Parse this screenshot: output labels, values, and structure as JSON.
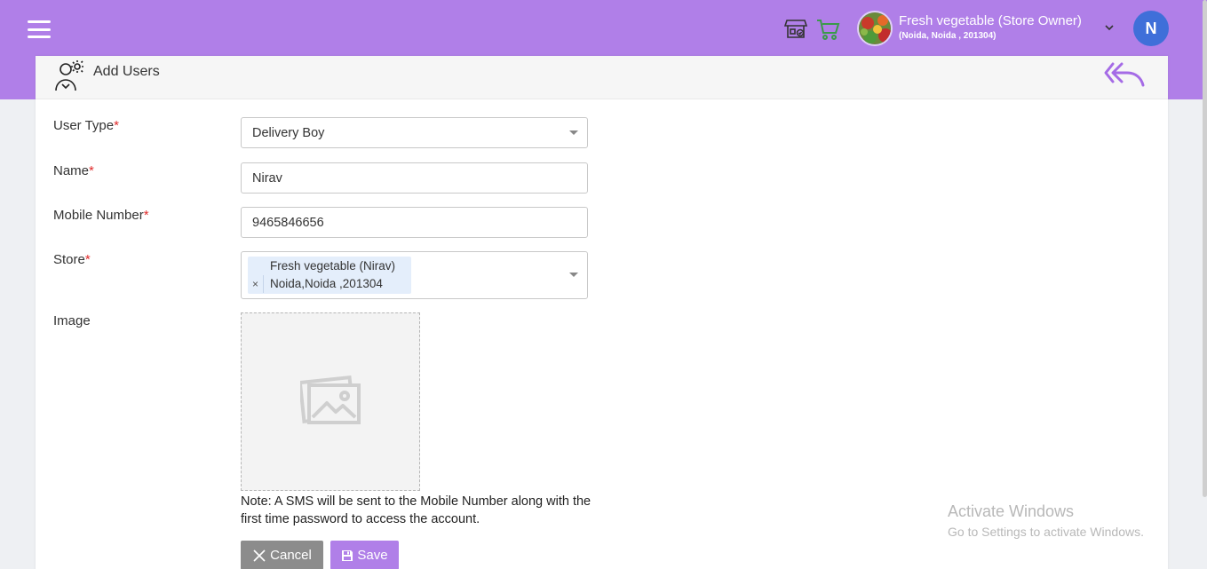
{
  "header": {
    "store_name": "Fresh vegetable (Store Owner)",
    "store_address": "(Noida, Noida , 201304)",
    "user_initial": "N",
    "icons": [
      "menu-icon",
      "store-icon",
      "cart-icon",
      "chevron-down-icon"
    ]
  },
  "page": {
    "title": "Add Users"
  },
  "form": {
    "user_type_label": "User Type",
    "user_type_value": "Delivery Boy",
    "name_label": "Name",
    "name_value": "Nirav",
    "mobile_label": "Mobile Number",
    "mobile_value": "9465846656",
    "store_label": "Store",
    "store_tag_line1": "Fresh vegetable (Nirav)",
    "store_tag_line2": "Noida,Noida ,201304",
    "store_tag_remove": "×",
    "image_label": "Image",
    "required_mark": "*",
    "note": "Note: A SMS will be sent to the Mobile Number along with the first time password to access the account."
  },
  "actions": {
    "cancel_label": "Cancel",
    "save_label": "Save"
  },
  "watermark": {
    "line1": "Activate Windows",
    "line2": "Go to Settings to activate Windows."
  },
  "colors": {
    "primary": "#b07fe8",
    "avatar": "#3f6fd9",
    "required": "#e02b2b",
    "cancel": "#8c8c8c"
  }
}
